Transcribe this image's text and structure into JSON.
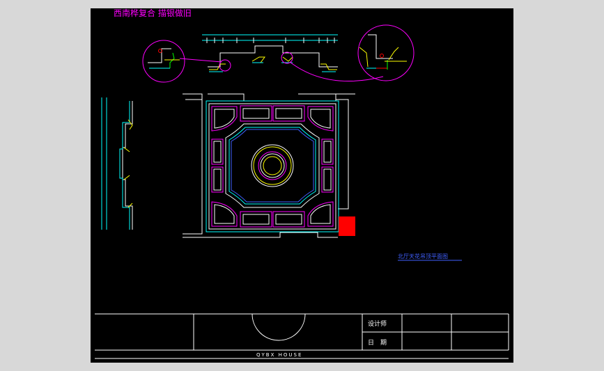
{
  "drawing": {
    "title": "西南桦复合 描银做旧",
    "plan_label": "北厅天花吊顶平面图",
    "footer_text": "QYBX HOUSE",
    "title_block": {
      "designer_label": "设计师",
      "date_label": "日　期"
    },
    "colors": {
      "background": "#000000",
      "panel": "#ff00ff",
      "outline": "#ffffff",
      "cyan": "#00ffff",
      "yellow": "#ffff00",
      "red": "#ff0000",
      "blue": "#4060ff",
      "green": "#00ff00"
    }
  }
}
